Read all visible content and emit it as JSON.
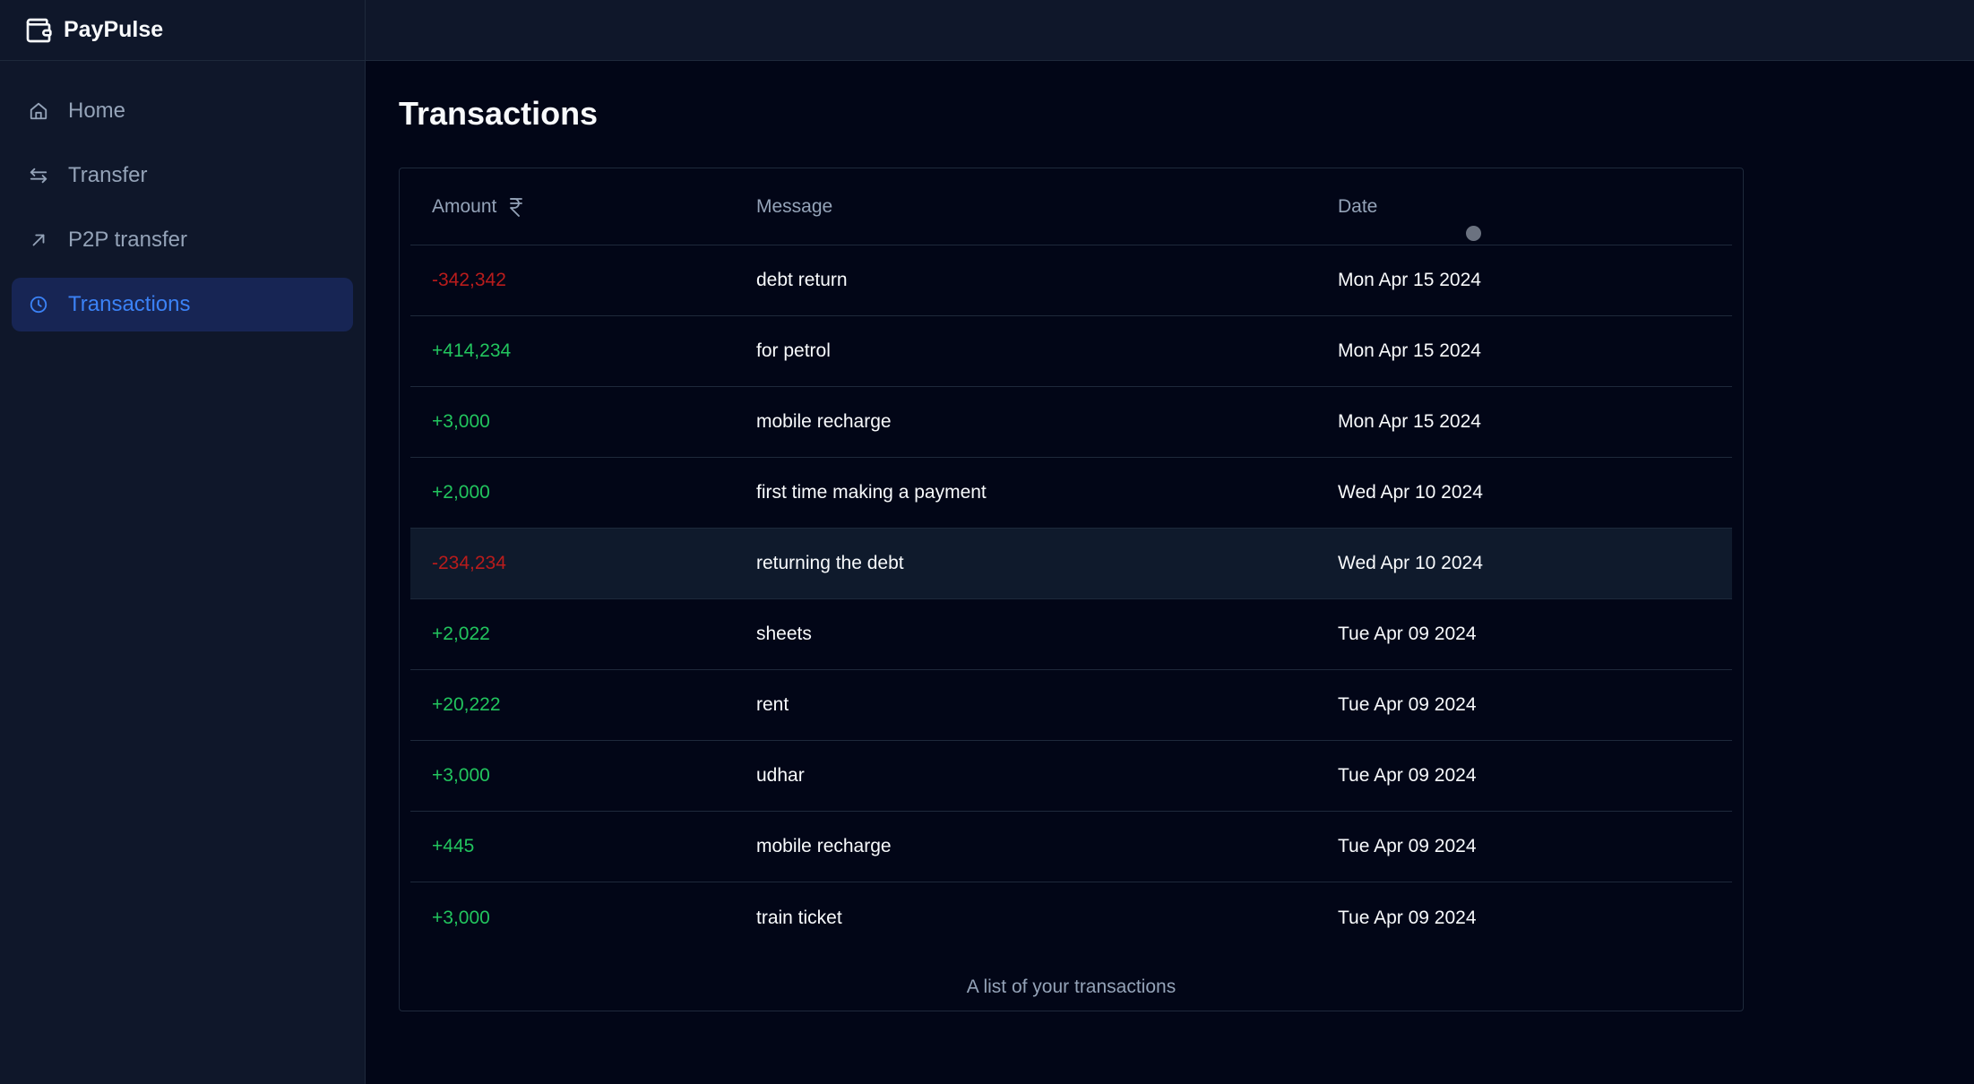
{
  "app": {
    "name": "PayPulse"
  },
  "sidebar": {
    "items": [
      {
        "label": "Home",
        "icon": "home-icon",
        "active": false
      },
      {
        "label": "Transfer",
        "icon": "transfer-arrows-icon",
        "active": false
      },
      {
        "label": "P2P transfer",
        "icon": "arrow-up-right-icon",
        "active": false
      },
      {
        "label": "Transactions",
        "icon": "clock-icon",
        "active": true
      }
    ]
  },
  "page": {
    "title": "Transactions"
  },
  "table": {
    "headers": {
      "amount": "Amount",
      "currency_icon": "rupee-icon",
      "message": "Message",
      "date": "Date"
    },
    "rows": [
      {
        "amount": "-342,342",
        "message": "debt return",
        "date": "Mon Apr 15 2024"
      },
      {
        "amount": "+414,234",
        "message": "for petrol",
        "date": "Mon Apr 15 2024"
      },
      {
        "amount": "+3,000",
        "message": "mobile recharge",
        "date": "Mon Apr 15 2024"
      },
      {
        "amount": "+2,000",
        "message": "first time making a payment",
        "date": "Wed Apr 10 2024"
      },
      {
        "amount": "-234,234",
        "message": "returning the debt",
        "date": "Wed Apr 10 2024"
      },
      {
        "amount": "+2,022",
        "message": "sheets",
        "date": "Tue Apr 09 2024"
      },
      {
        "amount": "+20,222",
        "message": "rent",
        "date": "Tue Apr 09 2024"
      },
      {
        "amount": "+3,000",
        "message": "udhar",
        "date": "Tue Apr 09 2024"
      },
      {
        "amount": "+445",
        "message": "mobile recharge",
        "date": "Tue Apr 09 2024"
      },
      {
        "amount": "+3,000",
        "message": "train ticket",
        "date": "Tue Apr 09 2024"
      }
    ],
    "caption": "A list of your transactions"
  },
  "colors": {
    "accent": "#3b82f6",
    "positive": "#22c55e",
    "negative": "#b91c1c",
    "background": "#020617",
    "sidebar": "#0f172a"
  }
}
